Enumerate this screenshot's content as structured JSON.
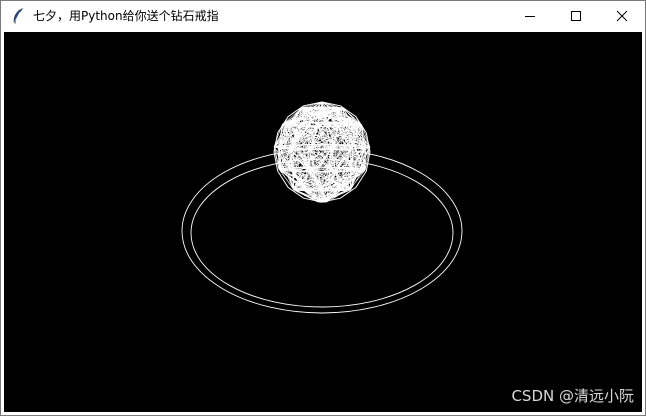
{
  "window": {
    "title": "七夕，用Python给你送个钻石戒指",
    "app_icon": "feather-icon",
    "controls": [
      "minimize-icon",
      "maximize-icon",
      "close-icon"
    ]
  },
  "canvas": {
    "background": "#000000",
    "stroke_color": "#ffffff"
  },
  "watermark": {
    "text": "CSDN @清远小阮"
  }
}
